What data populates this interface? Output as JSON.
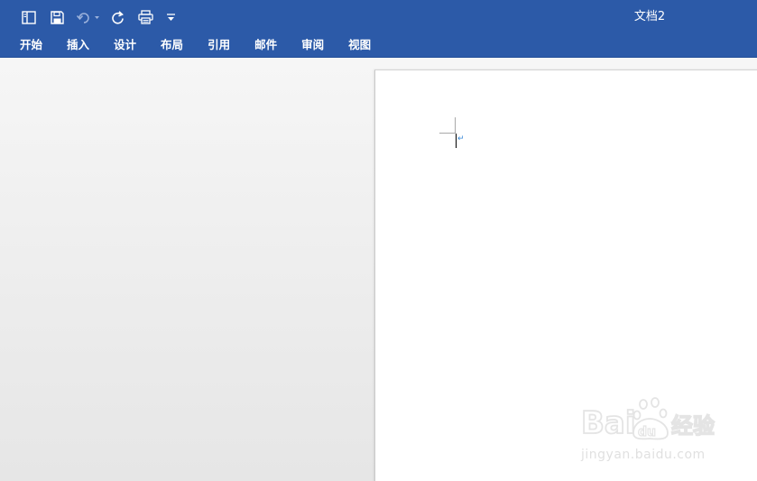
{
  "window": {
    "doc_title": "文档2"
  },
  "quick_access": [
    {
      "name": "sidebar-toggle-icon"
    },
    {
      "name": "save-icon"
    },
    {
      "name": "undo-icon"
    },
    {
      "name": "redo-icon"
    },
    {
      "name": "print-icon"
    },
    {
      "name": "customize-toolbar-icon"
    }
  ],
  "ribbon": {
    "tabs": [
      {
        "label": "开始"
      },
      {
        "label": "插入"
      },
      {
        "label": "设计"
      },
      {
        "label": "布局"
      },
      {
        "label": "引用"
      },
      {
        "label": "邮件"
      },
      {
        "label": "审阅"
      },
      {
        "label": "视图"
      }
    ]
  },
  "document": {
    "paragraph_mark": "↵"
  },
  "watermark": {
    "logo_text": "Baidu经验",
    "url": "jingyan.baidu.com"
  },
  "colors": {
    "ribbon_blue": "#2c5aa8",
    "page_white": "#ffffff",
    "workspace_gray": "#ececec"
  }
}
